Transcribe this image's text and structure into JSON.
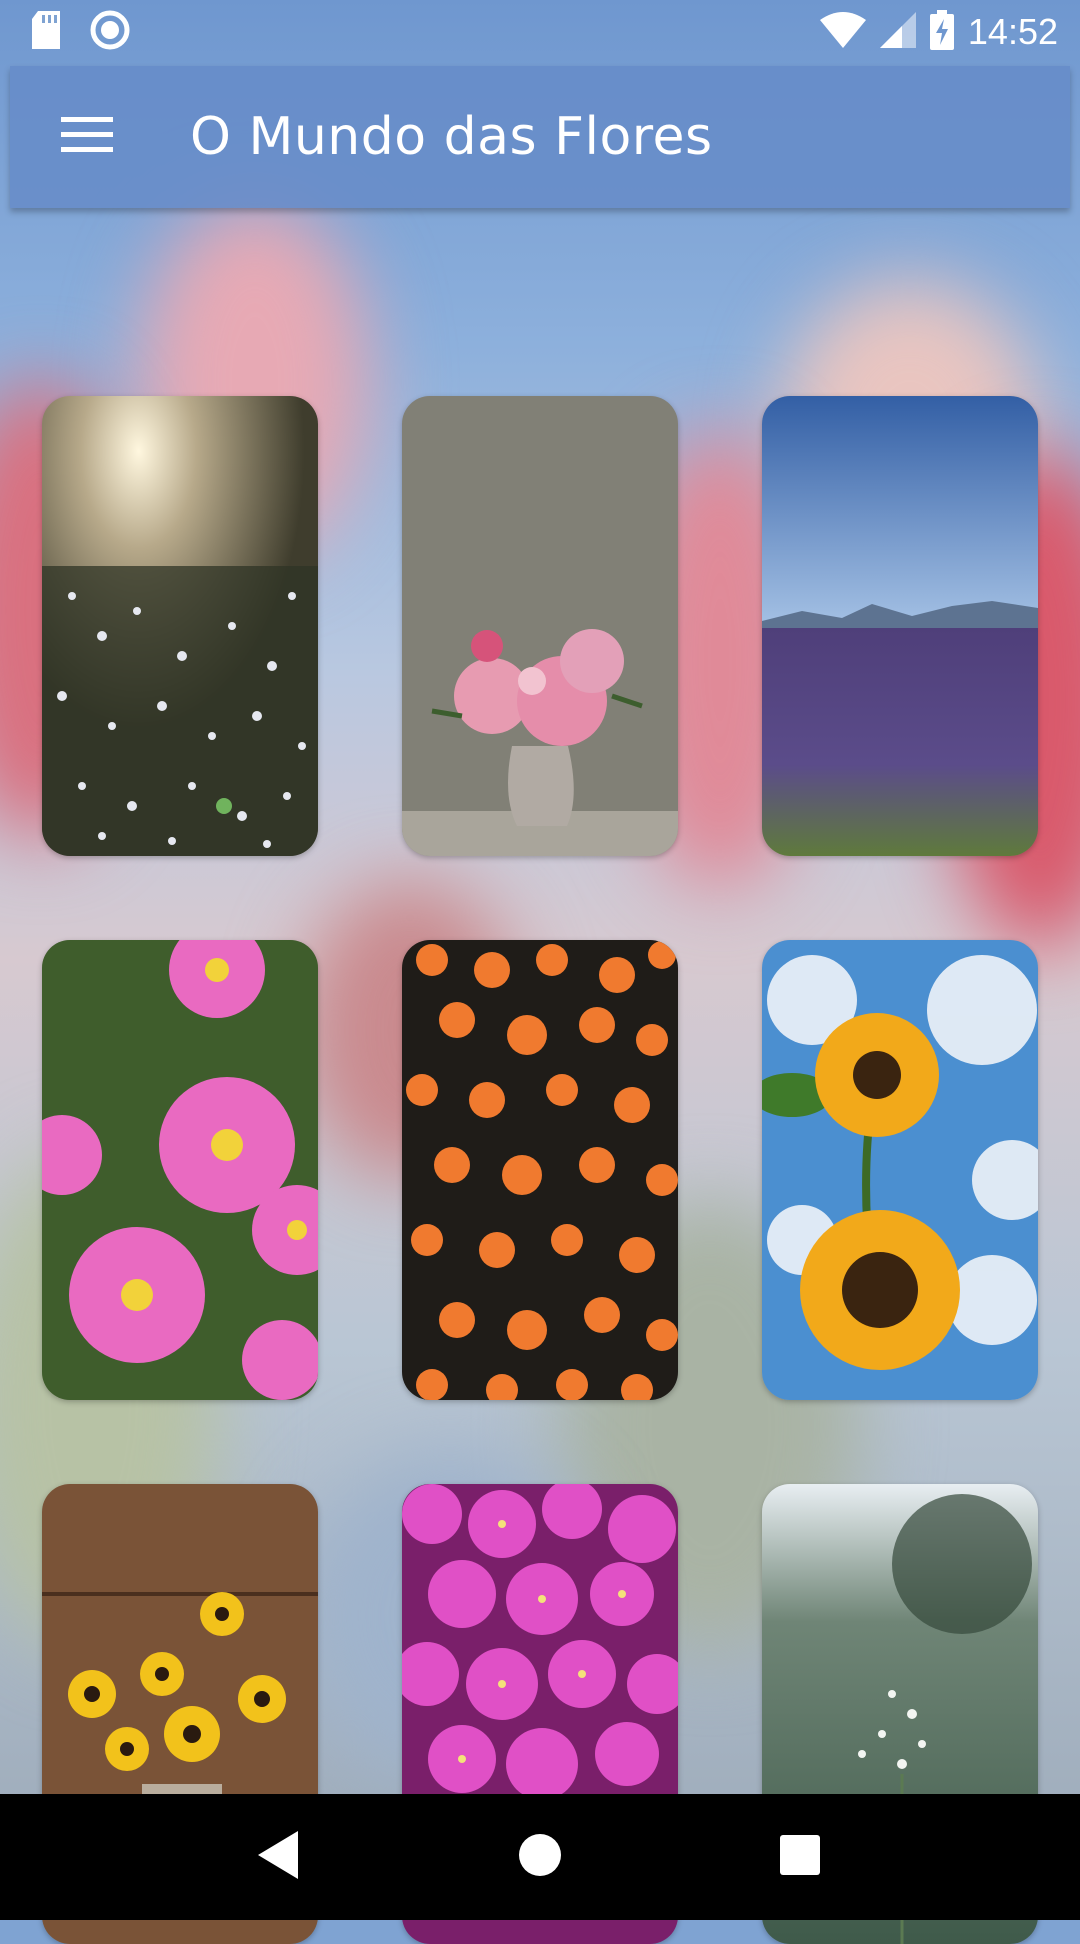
{
  "status_bar": {
    "time": "14:52",
    "icons": [
      "sd-card-icon",
      "sync-icon",
      "wifi-icon",
      "signal-icon",
      "battery-charging-icon"
    ]
  },
  "app_bar": {
    "title": "O Mundo das Flores",
    "menu_icon": "hamburger-menu-icon"
  },
  "gallery": {
    "items": [
      {
        "subject": "white-wildflowers-sunset"
      },
      {
        "subject": "pink-peonies-vase"
      },
      {
        "subject": "lavender-field-mountains"
      },
      {
        "subject": "pink-asters"
      },
      {
        "subject": "orange-marigolds"
      },
      {
        "subject": "sunflowers-sky"
      },
      {
        "subject": "black-eyed-susans-jar"
      },
      {
        "subject": "magenta-bougainvillea"
      },
      {
        "subject": "white-wildflowers-blur"
      }
    ]
  },
  "nav_bar": {
    "buttons": [
      "back-icon",
      "home-icon",
      "recents-icon"
    ]
  },
  "colors": {
    "app_bar": "#668cc8",
    "nav_bar": "#000000",
    "text": "#ffffff"
  }
}
